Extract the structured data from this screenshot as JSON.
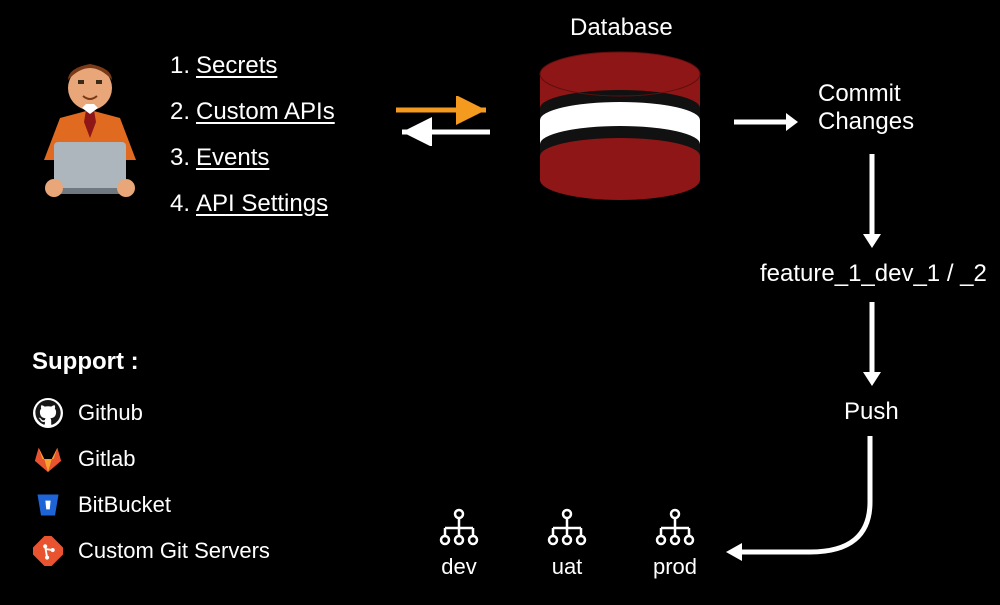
{
  "list": {
    "i1": "Secrets",
    "i2": "Custom APIs",
    "i3": "Events",
    "i4": "API Settings",
    "n1": "1.",
    "n2": "2.",
    "n3": "3.",
    "n4": "4."
  },
  "database_label": "Database",
  "commit": {
    "l1": "Commit",
    "l2": "Changes"
  },
  "branch": "feature_1_dev_1 / _2",
  "push": "Push",
  "env": {
    "dev": "dev",
    "uat": "uat",
    "prod": "prod"
  },
  "support": {
    "title": "Support :",
    "github": "Github",
    "gitlab": "Gitlab",
    "bitbucket": "BitBucket",
    "custom": "Custom Git Servers"
  }
}
